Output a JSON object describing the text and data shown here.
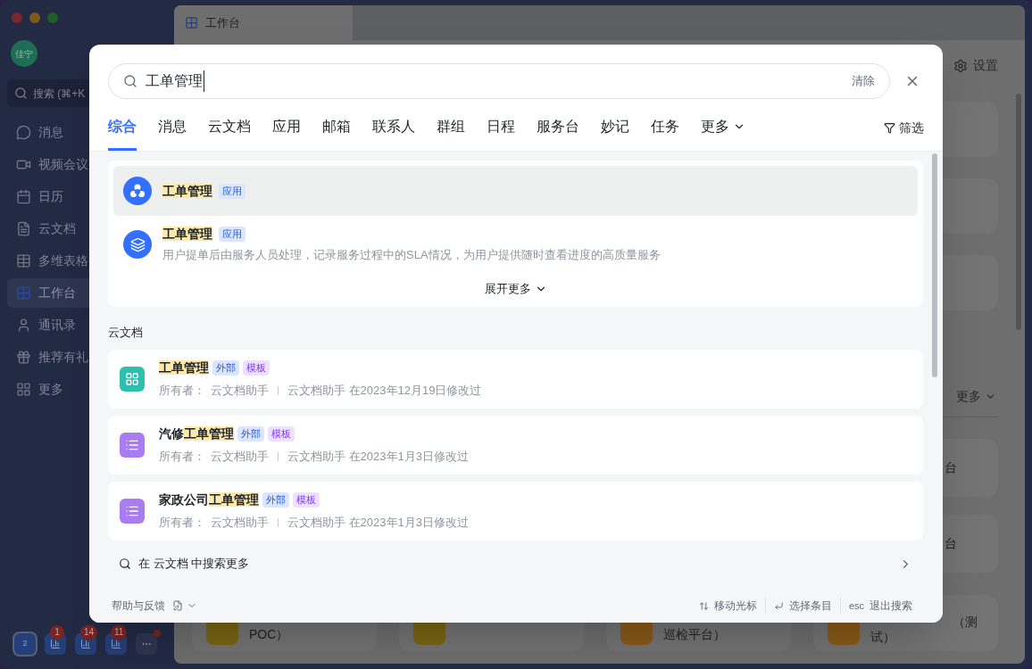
{
  "sidebar": {
    "avatar": "佳宁",
    "search_placeholder": "搜索 (⌘+K",
    "items": [
      {
        "kind": "chat",
        "label": "消息",
        "selected": false
      },
      {
        "kind": "video",
        "label": "视频会议",
        "selected": false
      },
      {
        "kind": "calendar",
        "label": "日历",
        "selected": false
      },
      {
        "kind": "docs",
        "label": "云文档",
        "selected": false
      },
      {
        "kind": "table",
        "label": "多维表格",
        "selected": false
      },
      {
        "kind": "workbench",
        "label": "工作台",
        "selected": true
      },
      {
        "kind": "contacts",
        "label": "通讯录",
        "selected": false
      },
      {
        "kind": "gift",
        "label": "推荐有礼",
        "selected": false
      },
      {
        "kind": "more",
        "label": "更多",
        "selected": false
      }
    ],
    "dock": [
      {
        "kind": "space",
        "label": "2",
        "selected": true
      },
      {
        "kind": "app",
        "badge": "1",
        "selected": false
      },
      {
        "kind": "app",
        "badge": "14",
        "selected": false
      },
      {
        "kind": "app",
        "badge": "11",
        "selected": false
      },
      {
        "kind": "more",
        "dot": true,
        "selected": false
      }
    ]
  },
  "main": {
    "tab": "工作台",
    "settings": "设置",
    "more": "更多",
    "side_cards": [
      "台",
      "台"
    ],
    "bottom_cards": [
      {
        "kind": "app",
        "lines": [
          "POC）"
        ]
      },
      {
        "kind": "app"
      },
      {
        "kind": "app",
        "lines": [
          "巡检平台）"
        ]
      },
      {
        "kind": "app",
        "lines": [
          "（测",
          "试）"
        ]
      }
    ]
  },
  "search_dialog": {
    "search": {
      "value": "工单管理",
      "clear": "清除"
    },
    "tabs": [
      {
        "label": "综合",
        "selected": true
      },
      {
        "label": "消息",
        "selected": false
      },
      {
        "label": "云文档",
        "selected": false
      },
      {
        "label": "应用",
        "selected": false
      },
      {
        "label": "邮箱",
        "selected": false
      },
      {
        "label": "联系人",
        "selected": false
      },
      {
        "label": "群组",
        "selected": false
      },
      {
        "label": "日程",
        "selected": false
      },
      {
        "label": "服务台",
        "selected": false
      },
      {
        "label": "妙记",
        "selected": false
      },
      {
        "label": "任务",
        "selected": false
      }
    ],
    "more_tab": "更多",
    "filter": "筛选",
    "apps": [
      {
        "title": [
          {
            "text": "工单管理",
            "highlight": true
          }
        ],
        "tag": {
          "kind": "app",
          "label": "应用"
        },
        "selected": true
      },
      {
        "title": [
          {
            "text": "工单管理",
            "highlight": true
          }
        ],
        "tag": {
          "kind": "app",
          "label": "应用"
        },
        "description": "用户提单后由服务人员处理，记录服务过程中的SLA情况，为用户提供随时查看进度的高质量服务",
        "selected": false
      }
    ],
    "expand_more": "展开更多",
    "docs": {
      "heading": "云文档",
      "items": [
        {
          "title": [
            {
              "text": "工单管理",
              "highlight": true
            }
          ],
          "tags": [
            {
              "kind": "external",
              "label": "外部"
            },
            {
              "kind": "template",
              "label": "模板"
            }
          ],
          "owner_label": "所有者：",
          "owner": "云文档助手",
          "modified": "云文档助手 在2023年12月19日修改过"
        },
        {
          "title": [
            {
              "text": "汽修",
              "highlight": false
            },
            {
              "text": "工单管理",
              "highlight": true
            }
          ],
          "tags": [
            {
              "kind": "external",
              "label": "外部"
            },
            {
              "kind": "template",
              "label": "模板"
            }
          ],
          "owner_label": "所有者：",
          "owner": "云文档助手",
          "modified": "云文档助手 在2023年1月3日修改过"
        },
        {
          "title": [
            {
              "text": "家政公司",
              "highlight": false
            },
            {
              "text": "工单管理",
              "highlight": true
            }
          ],
          "tags": [
            {
              "kind": "external",
              "label": "外部"
            },
            {
              "kind": "template",
              "label": "模板"
            }
          ],
          "owner_label": "所有者：",
          "owner": "云文档助手",
          "modified": "云文档助手 在2023年1月3日修改过"
        }
      ],
      "search_more": "在 云文档 中搜索更多"
    },
    "footer": {
      "help": "帮助与反馈",
      "hints": [
        {
          "kind": "arrows",
          "label": "移动光标"
        },
        {
          "kind": "enter",
          "label": "选择条目"
        },
        {
          "kind": "key",
          "key": "esc",
          "label": "退出搜索"
        }
      ]
    }
  }
}
